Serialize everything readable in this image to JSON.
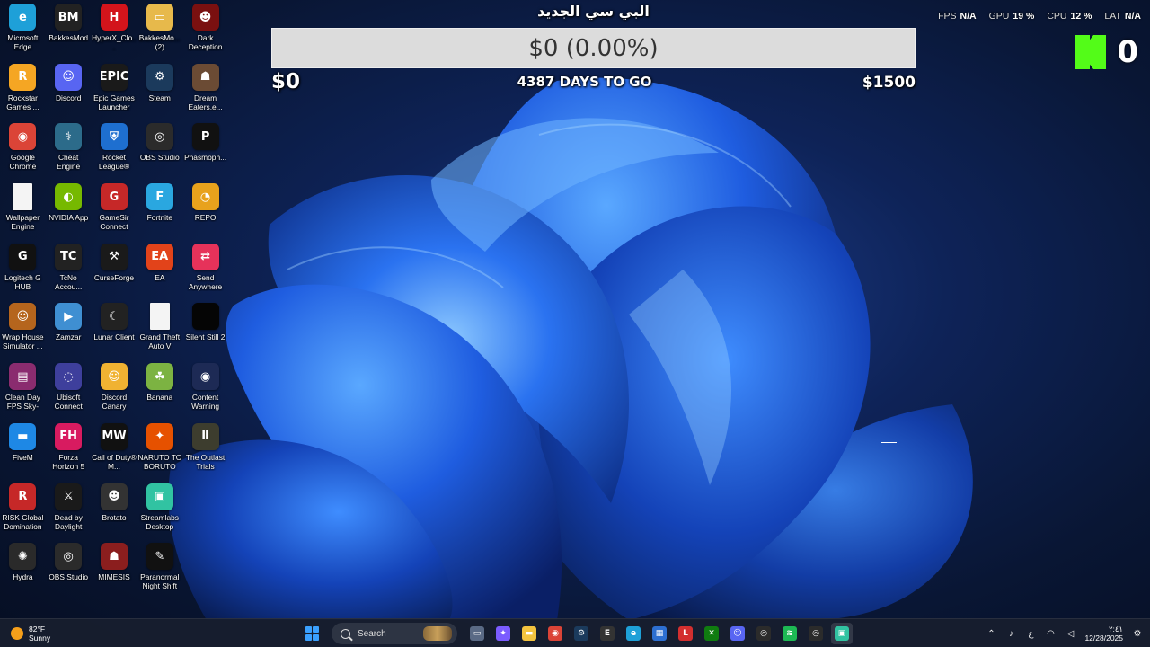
{
  "desktop_icons": [
    {
      "label": "Microsoft Edge",
      "icon": "edge-icon",
      "color": "#1ea0d8",
      "glyph": "e"
    },
    {
      "label": "BakkesMod",
      "icon": "bakkesmod-icon",
      "color": "#222222",
      "glyph": "BM"
    },
    {
      "label": "HyperX_Clo...",
      "icon": "hyperx-icon",
      "color": "#d3141b",
      "glyph": "H"
    },
    {
      "label": "BakkesMo... (2)",
      "icon": "folder-icon",
      "color": "#e7b94b",
      "glyph": "▭"
    },
    {
      "label": "Dark Deception",
      "icon": "dark-deception-icon",
      "color": "#7a1010",
      "glyph": "☻"
    },
    {
      "label": "Rockstar Games ...",
      "icon": "rockstar-icon",
      "color": "#f5a623",
      "glyph": "R"
    },
    {
      "label": "Discord",
      "icon": "discord-icon",
      "color": "#5865f2",
      "glyph": "☺"
    },
    {
      "label": "Epic Games Launcher",
      "icon": "epic-games-icon",
      "color": "#1a1a1a",
      "glyph": "EPIC"
    },
    {
      "label": "Steam",
      "icon": "steam-icon",
      "color": "#1b3a5c",
      "glyph": "⚙"
    },
    {
      "label": "Dream Eaters.e...",
      "icon": "dream-eaters-icon",
      "color": "#6b4b34",
      "glyph": "☗"
    },
    {
      "label": "Google Chrome",
      "icon": "chrome-icon",
      "color": "#db4437",
      "glyph": "◉"
    },
    {
      "label": "Cheat Engine",
      "icon": "cheat-engine-icon",
      "color": "#2c6b8a",
      "glyph": "⚕"
    },
    {
      "label": "Rocket League®",
      "icon": "rocket-league-icon",
      "color": "#1e6fd0",
      "glyph": "⛨"
    },
    {
      "label": "OBS Studio",
      "icon": "obs-icon",
      "color": "#2b2b2b",
      "glyph": "◎"
    },
    {
      "label": "Phasmoph...",
      "icon": "phasmophobia-icon",
      "color": "#111111",
      "glyph": "P"
    },
    {
      "label": "Wallpaper Engine",
      "icon": "file-icon",
      "color": "#f4f4f4",
      "glyph": ""
    },
    {
      "label": "NVIDIA App",
      "icon": "nvidia-icon",
      "color": "#76b900",
      "glyph": "◐"
    },
    {
      "label": "GameSir Connect",
      "icon": "gamesir-icon",
      "color": "#c62828",
      "glyph": "G"
    },
    {
      "label": "Fortnite",
      "icon": "fortnite-icon",
      "color": "#2aa7e0",
      "glyph": "F"
    },
    {
      "label": "REPO",
      "icon": "repo-icon",
      "color": "#e8a21c",
      "glyph": "◔"
    },
    {
      "label": "Logitech G HUB",
      "icon": "logitech-icon",
      "color": "#111111",
      "glyph": "G"
    },
    {
      "label": "TcNo Accou...",
      "icon": "tcno-icon",
      "color": "#222222",
      "glyph": "TC"
    },
    {
      "label": "CurseForge",
      "icon": "curseforge-icon",
      "color": "#1a1a1a",
      "glyph": "⚒"
    },
    {
      "label": "EA",
      "icon": "ea-icon",
      "color": "#e2431a",
      "glyph": "EA"
    },
    {
      "label": "Send Anywhere",
      "icon": "send-anywhere-icon",
      "color": "#e6325a",
      "glyph": "⇄"
    },
    {
      "label": "Wrap House Simulator ...",
      "icon": "wrap-house-icon",
      "color": "#b5651d",
      "glyph": "☺"
    },
    {
      "label": "Zamzar",
      "icon": "zamzar-icon",
      "color": "#3f8fd2",
      "glyph": "▶"
    },
    {
      "label": "Lunar Client",
      "icon": "lunar-client-icon",
      "color": "#222222",
      "glyph": "☾"
    },
    {
      "label": "Grand Theft Auto V",
      "icon": "file-icon",
      "color": "#f4f4f4",
      "glyph": ""
    },
    {
      "label": "Silent Still 2",
      "icon": "silent-still-icon",
      "color": "#050505",
      "glyph": ""
    },
    {
      "label": "Clean Day FPS Sky-Pa...",
      "icon": "winrar-icon",
      "color": "#8a2c6f",
      "glyph": "▤"
    },
    {
      "label": "Ubisoft Connect",
      "icon": "ubisoft-icon",
      "color": "#3e3f9c",
      "glyph": "◌"
    },
    {
      "label": "Discord Canary",
      "icon": "discord-canary-icon",
      "color": "#f0b232",
      "glyph": "☺"
    },
    {
      "label": "Banana",
      "icon": "banana-icon",
      "color": "#7cb342",
      "glyph": "☘"
    },
    {
      "label": "Content Warning",
      "icon": "content-warning-icon",
      "color": "#1d2a55",
      "glyph": "◉"
    },
    {
      "label": "FiveM",
      "icon": "fivem-icon",
      "color": "#1e88e5",
      "glyph": "▬"
    },
    {
      "label": "Forza Horizon 5",
      "icon": "forza-icon",
      "color": "#d81b60",
      "glyph": "FH"
    },
    {
      "label": "Call of Duty® M...",
      "icon": "call-of-duty-icon",
      "color": "#111111",
      "glyph": "MW"
    },
    {
      "label": "NARUTO TO BORUTO S...",
      "icon": "naruto-icon",
      "color": "#e65100",
      "glyph": "✦"
    },
    {
      "label": "The Outlast Trials",
      "icon": "outlast-icon",
      "color": "#3d3d2e",
      "glyph": "Ⅱ"
    },
    {
      "label": "RISK Global Domination",
      "icon": "risk-icon",
      "color": "#c62828",
      "glyph": "R"
    },
    {
      "label": "Dead by Daylight",
      "icon": "dead-by-daylight-icon",
      "color": "#1a1a1a",
      "glyph": "⚔"
    },
    {
      "label": "Brotato",
      "icon": "brotato-icon",
      "color": "#333333",
      "glyph": "☻"
    },
    {
      "label": "Streamlabs Desktop",
      "icon": "streamlabs-icon",
      "color": "#31c3a2",
      "glyph": "▣"
    },
    {
      "label": "",
      "icon": "empty-icon",
      "color": "transparent",
      "glyph": ""
    },
    {
      "label": "Hydra",
      "icon": "hydra-icon",
      "color": "#2a2a2a",
      "glyph": "✺"
    },
    {
      "label": "OBS Studio",
      "icon": "obs-icon",
      "color": "#2b2b2b",
      "glyph": "◎"
    },
    {
      "label": "MIMESIS",
      "icon": "mimesis-icon",
      "color": "#8b1e1e",
      "glyph": "☗"
    },
    {
      "label": "Paranormal Night Shift",
      "icon": "paranormal-icon",
      "color": "#111111",
      "glyph": "✎"
    }
  ],
  "overlay": {
    "title": "البي سي الجديد",
    "bar_text": "$0 (0.00%)",
    "progress_fraction": 0.0,
    "min_label": "$0",
    "days_label": "4387 DAYS TO GO",
    "max_label": "$1500"
  },
  "perf": {
    "fps_label": "FPS",
    "fps_value": "N/A",
    "gpu_label": "GPU",
    "gpu_value": "19 %",
    "cpu_label": "CPU",
    "cpu_value": "12 %",
    "lat_label": "LAT",
    "lat_value": "N/A"
  },
  "kick": {
    "count": "0",
    "brand_color": "#53fc18"
  },
  "taskbar": {
    "weather_temp": "82°F",
    "weather_desc": "Sunny",
    "search_placeholder": "Search",
    "pinned": [
      {
        "icon": "task-view-icon",
        "glyph": "▭",
        "color": "#5a6a85"
      },
      {
        "icon": "copilot-icon",
        "glyph": "✦",
        "color": "#7b5cff"
      },
      {
        "icon": "file-explorer-icon",
        "glyph": "▬",
        "color": "#f3c33f"
      },
      {
        "icon": "chrome-icon",
        "glyph": "◉",
        "color": "#db4437"
      },
      {
        "icon": "steam-icon",
        "glyph": "⚙",
        "color": "#1b3a5c"
      },
      {
        "icon": "epic-games-icon",
        "glyph": "E",
        "color": "#333333"
      },
      {
        "icon": "edge-icon",
        "glyph": "e",
        "color": "#1ea0d8"
      },
      {
        "icon": "store-icon",
        "glyph": "▦",
        "color": "#2d6fd1"
      },
      {
        "icon": "lunar-l-icon",
        "glyph": "L",
        "color": "#d32f2f"
      },
      {
        "icon": "xbox-icon",
        "glyph": "✕",
        "color": "#107c10"
      },
      {
        "icon": "discord-icon",
        "glyph": "☺",
        "color": "#5865f2"
      },
      {
        "icon": "obs-icon",
        "glyph": "◎",
        "color": "#2b2b2b"
      },
      {
        "icon": "spotify-icon",
        "glyph": "≋",
        "color": "#1db954"
      },
      {
        "icon": "obs-icon",
        "glyph": "◎",
        "color": "#2b2b2b"
      },
      {
        "icon": "streamlabs-icon",
        "glyph": "▣",
        "color": "#31c3a2"
      }
    ],
    "lang": "ع",
    "time": "٢:٤١",
    "date": "12/28/2025"
  }
}
